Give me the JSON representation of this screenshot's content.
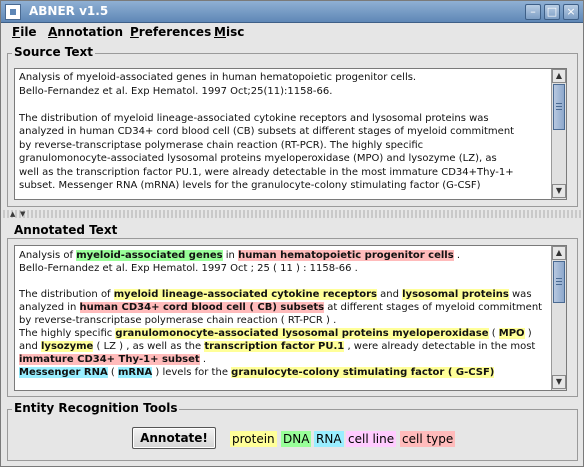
{
  "window": {
    "title": "ABNER v1.5"
  },
  "menu": [
    {
      "mnemonic": "F",
      "rest": "ile"
    },
    {
      "mnemonic": "A",
      "rest": "nnotation"
    },
    {
      "mnemonic": "P",
      "rest": "references"
    },
    {
      "mnemonic": "M",
      "rest": "isc"
    }
  ],
  "source": {
    "title": "Source Text",
    "text": "Analysis of myeloid-associated genes in human hematopoietic progenitor cells.\nBello-Fernandez et al. Exp Hematol.  1997 Oct;25(11):1158-66.\n\nThe distribution of myeloid lineage-associated cytokine receptors and lysosomal proteins was\nanalyzed in human CD34+ cord blood cell (CB) subsets at different stages of myeloid commitment\nby reverse-transcriptase polymerase chain reaction (RT-PCR). The highly specific\ngranulomonocyte-associated lysosomal proteins myeloperoxidase (MPO) and lysozyme (LZ), as\nwell as the transcription factor PU.1, were already detectable in the most immature CD34+Thy-1+\nsubset. Messenger RNA (mRNA) levels for the granulocyte-colony stimulating factor (G-CSF)"
  },
  "annotated": {
    "title": "Annotated Text",
    "paragraphs": [
      [
        {
          "t": "Analysis of "
        },
        {
          "t": "myeloid-associated genes",
          "type": "dna"
        },
        {
          "t": " in "
        },
        {
          "t": "human hematopoietic progenitor cells",
          "type": "celltype"
        },
        {
          "t": " ."
        }
      ],
      [
        {
          "t": "Bello-Fernandez et al. Exp Hematol. 1997 Oct ; 25 ( 11 ) : 1158-66 ."
        }
      ],
      [],
      [
        {
          "t": "The distribution of "
        },
        {
          "t": "myeloid lineage-associated cytokine receptors",
          "type": "protein"
        },
        {
          "t": " and "
        },
        {
          "t": "lysosomal proteins",
          "type": "protein"
        },
        {
          "t": " was analyzed in "
        },
        {
          "t": "human CD34+ cord blood cell ( CB) subsets",
          "type": "celltype"
        },
        {
          "t": " at different stages of myeloid commitment by reverse-transcriptase polymerase chain reaction ( RT-PCR ) ."
        }
      ],
      [
        {
          "t": "The highly specific "
        },
        {
          "t": "granulomonocyte-associated lysosomal proteins myeloperoxidase",
          "type": "protein"
        },
        {
          "t": " ( "
        },
        {
          "t": "MPO",
          "type": "protein"
        },
        {
          "t": " ) and "
        },
        {
          "t": "lysozyme",
          "type": "protein"
        },
        {
          "t": " ( LZ ) , as well as the "
        },
        {
          "t": "transcription factor PU.1",
          "type": "protein"
        },
        {
          "t": " , were already detectable in the most "
        },
        {
          "t": "immature CD34+ Thy-1+ subset",
          "type": "celltype"
        },
        {
          "t": " ."
        }
      ],
      [
        {
          "t": "Messenger RNA",
          "type": "rna"
        },
        {
          "t": " ( "
        },
        {
          "t": "mRNA",
          "type": "rna"
        },
        {
          "t": " ) levels for the "
        },
        {
          "t": "granulocyte-colony stimulating factor ( G-CSF)",
          "type": "protein"
        }
      ]
    ]
  },
  "tools": {
    "title": "Entity Recognition Tools",
    "annotate_label": "Annotate!",
    "legend": [
      {
        "label": "protein",
        "type": "protein"
      },
      {
        "label": "DNA",
        "type": "dna"
      },
      {
        "label": "RNA",
        "type": "rna"
      },
      {
        "label": "cell line",
        "type": "cellline"
      },
      {
        "label": "cell type",
        "type": "celltype"
      }
    ]
  },
  "colors": {
    "protein": "#ffff99",
    "dna": "#99ff99",
    "rna": "#99eeff",
    "cellline": "#ffccff",
    "celltype": "#ffbbbb"
  },
  "icons": {
    "minimize": "minimize-icon",
    "maximize": "maximize-icon",
    "close": "close-icon"
  }
}
